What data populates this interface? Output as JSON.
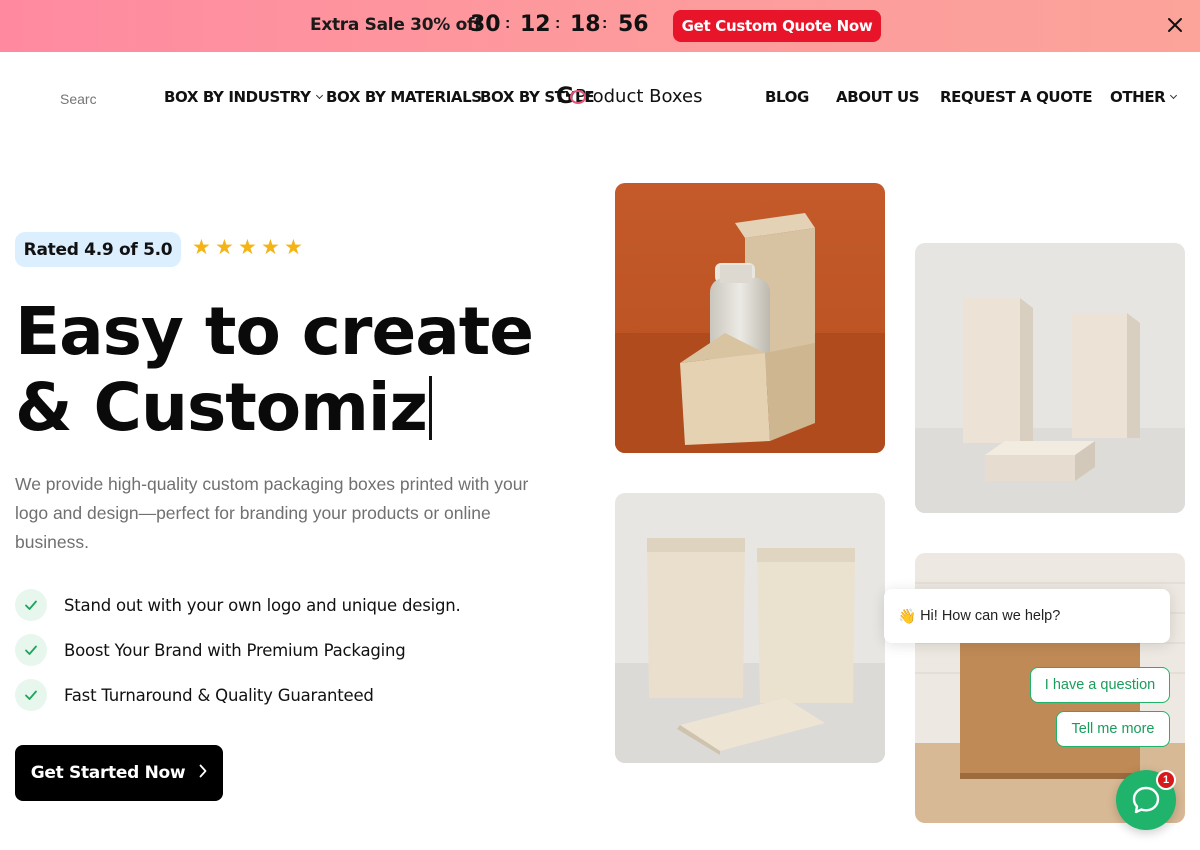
{
  "promo": {
    "text": "Extra Sale 30% off",
    "countdown": {
      "days": "30",
      "hours": "12",
      "minutes": "18",
      "seconds": "56",
      "separator": ":"
    },
    "button_label": "Get Custom Quote Now",
    "close_icon": "close-icon"
  },
  "nav": {
    "search_placeholder": "Search",
    "items_left": [
      {
        "label": "BOX BY INDUSTRY",
        "has_dropdown": true
      },
      {
        "label": "BOX BY MATERIALS",
        "has_dropdown": false
      },
      {
        "label": "BOX BY STYLE",
        "has_dropdown": false
      }
    ],
    "logo": {
      "mark": "G",
      "text": "Product Boxes"
    },
    "items_right": [
      {
        "label": "BLOG",
        "has_dropdown": false
      },
      {
        "label": "ABOUT US",
        "has_dropdown": false
      },
      {
        "label": "REQUEST A QUOTE",
        "has_dropdown": false
      },
      {
        "label": "OTHER",
        "has_dropdown": true
      }
    ]
  },
  "hero": {
    "rating_label": "Rated 4.9 of 5.0",
    "stars": 5,
    "headline_line1": "Easy to create",
    "headline_line2": "& Customiz",
    "description": "We provide high-quality custom packaging boxes printed with your logo and design—perfect for branding your products or online business.",
    "features": [
      "Stand out with your own logo and unique design.",
      "Boost Your Brand with Premium Packaging",
      "Fast Turnaround & Quality Guaranteed"
    ],
    "cta_label": "Get Started Now"
  },
  "images": [
    {
      "name": "bottle-in-kraft-box-image"
    },
    {
      "name": "white-boxes-image"
    },
    {
      "name": "kraft-pouches-image"
    },
    {
      "name": "mailer-box-image"
    }
  ],
  "chat": {
    "greeting_emoji": "👋",
    "greeting": "Hi! How can we help?",
    "options": [
      "I have a question",
      "Tell me more"
    ],
    "badge_count": "1"
  },
  "colors": {
    "promo_gradient_start": "#ff8aa0",
    "promo_gradient_end": "#fca39a",
    "promo_button": "#e8142a",
    "rating_bg": "#dcefff",
    "star": "#f5b416",
    "check_bg": "#e7f7ee",
    "chat_green": "#1fb36b",
    "cta_bg": "#000000"
  }
}
